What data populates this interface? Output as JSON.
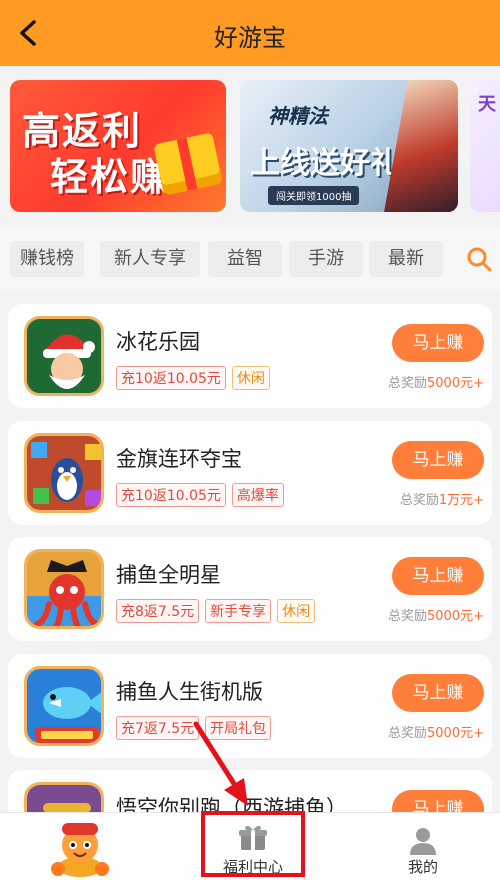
{
  "header": {
    "title": "好游宝"
  },
  "banners": [
    {
      "line1": "高返利",
      "line2": "轻松赚"
    },
    {
      "logo": "神精法",
      "title": "上线送好礼",
      "subtitle": "闯关即领1000抽"
    },
    {
      "title": "天"
    }
  ],
  "categories": [
    "赚钱榜",
    "新人专享",
    "益智",
    "手游",
    "最新"
  ],
  "games": [
    {
      "name": "冰花乐园",
      "tags": [
        {
          "text": "充10返10.05元",
          "style": "red"
        },
        {
          "text": "休闲",
          "style": "orange"
        }
      ],
      "button": "马上赚",
      "reward_label": "总奖励",
      "reward_amount": "5000元+"
    },
    {
      "name": "金旗连环夺宝",
      "tags": [
        {
          "text": "充10返10.05元",
          "style": "red"
        },
        {
          "text": "高爆率",
          "style": "red"
        }
      ],
      "button": "马上赚",
      "reward_label": "总奖励",
      "reward_amount": "1万元+"
    },
    {
      "name": "捕鱼全明星",
      "tags": [
        {
          "text": "充8返7.5元",
          "style": "red"
        },
        {
          "text": "新手专享",
          "style": "red"
        },
        {
          "text": "休闲",
          "style": "orange"
        }
      ],
      "button": "马上赚",
      "reward_label": "总奖励",
      "reward_amount": "5000元+"
    },
    {
      "name": "捕鱼人生街机版",
      "tags": [
        {
          "text": "充7返7.5元",
          "style": "red"
        },
        {
          "text": "开局礼包",
          "style": "red"
        }
      ],
      "button": "马上赚",
      "reward_label": "总奖励",
      "reward_amount": "5000元+"
    },
    {
      "name": "悟空你别跑（西游捕鱼）",
      "tags": [],
      "button": "马上赚",
      "reward_label": "",
      "reward_amount": ""
    }
  ],
  "tabbar": {
    "welfare": "福利中心",
    "mine": "我的"
  },
  "colors": {
    "header": "#ff9a22",
    "accent": "#ff7f3a",
    "highlight": "#e2131a"
  }
}
